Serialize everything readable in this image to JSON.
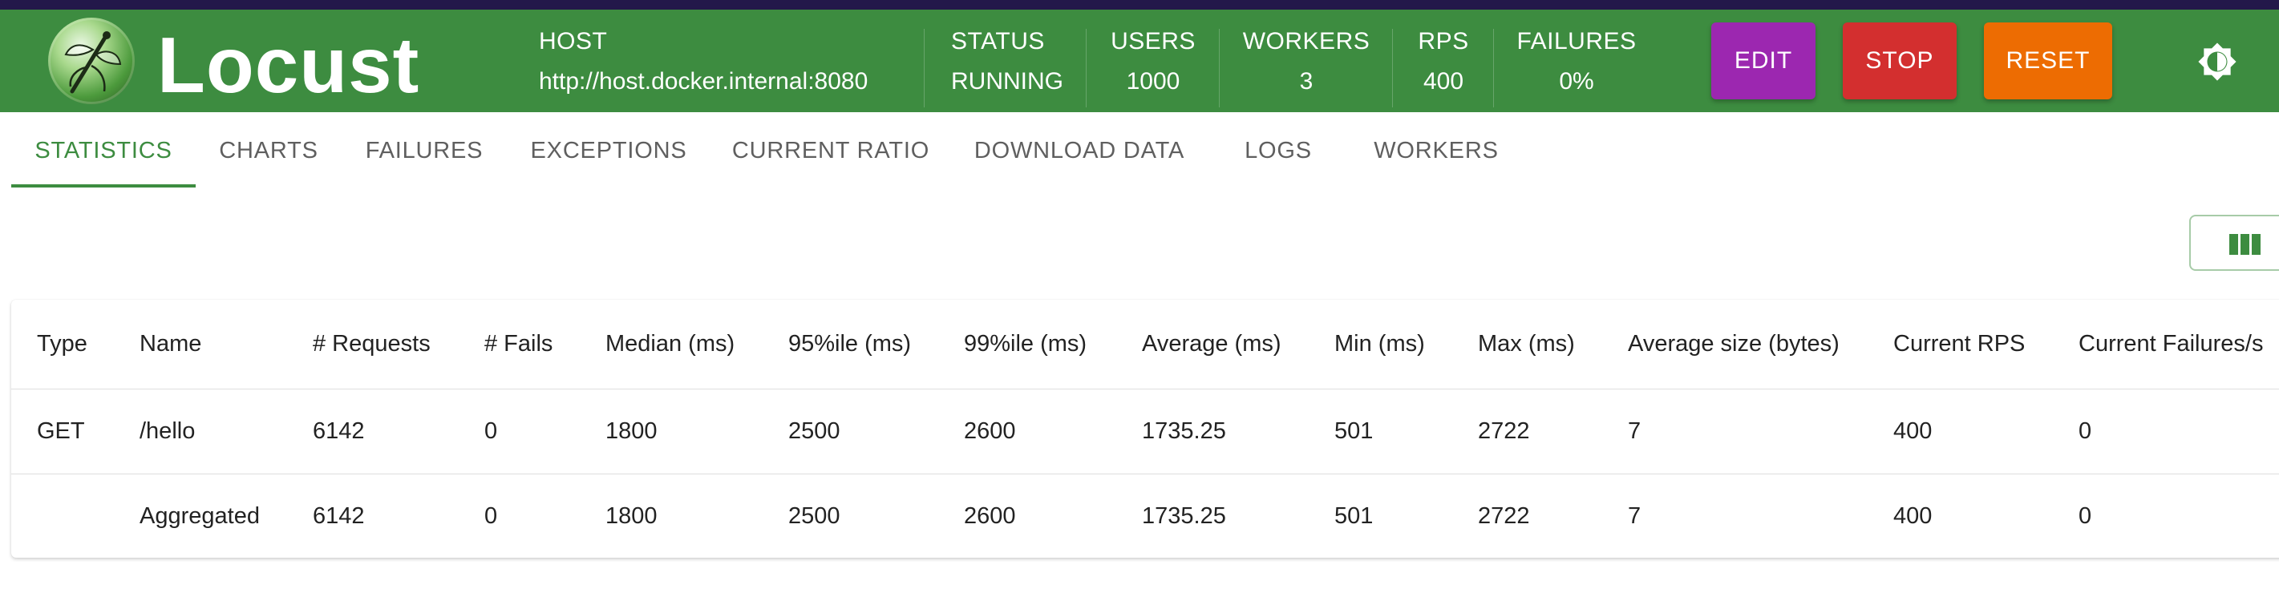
{
  "app": {
    "title": "Locust"
  },
  "stats": {
    "host": {
      "label": "HOST",
      "value": "http://host.docker.internal:8080"
    },
    "status": {
      "label": "STATUS",
      "value": "RUNNING"
    },
    "users": {
      "label": "USERS",
      "value": "1000"
    },
    "workers": {
      "label": "WORKERS",
      "value": "3"
    },
    "rps": {
      "label": "RPS",
      "value": "400"
    },
    "failures": {
      "label": "FAILURES",
      "value": "0%"
    }
  },
  "buttons": {
    "edit": {
      "label": "EDIT",
      "color": "#9c27b0"
    },
    "stop": {
      "label": "STOP",
      "color": "#d32f2f"
    },
    "reset": {
      "label": "RESET",
      "color": "#ed6c02"
    }
  },
  "icons": {
    "theme": "brightness-icon",
    "columns": "view-column-icon",
    "logo": "locust-logo-icon"
  },
  "colors": {
    "appbar": "#3d8c40",
    "accent": "#3d8c40",
    "topstrip": "#23184a"
  },
  "tabs": [
    {
      "label": "STATISTICS",
      "active": true
    },
    {
      "label": "CHARTS"
    },
    {
      "label": "FAILURES"
    },
    {
      "label": "EXCEPTIONS"
    },
    {
      "label": "CURRENT RATIO"
    },
    {
      "label": "DOWNLOAD DATA"
    },
    {
      "label": "LOGS"
    },
    {
      "label": "WORKERS"
    }
  ],
  "table": {
    "columns": [
      "Type",
      "Name",
      "# Requests",
      "# Fails",
      "Median (ms)",
      "95%ile (ms)",
      "99%ile (ms)",
      "Average (ms)",
      "Min (ms)",
      "Max (ms)",
      "Average size (bytes)",
      "Current RPS",
      "Current Failures/s"
    ],
    "rows": [
      [
        "GET",
        "/hello",
        "6142",
        "0",
        "1800",
        "2500",
        "2600",
        "1735.25",
        "501",
        "2722",
        "7",
        "400",
        "0"
      ],
      [
        "",
        "Aggregated",
        "6142",
        "0",
        "1800",
        "2500",
        "2600",
        "1735.25",
        "501",
        "2722",
        "7",
        "400",
        "0"
      ]
    ]
  }
}
